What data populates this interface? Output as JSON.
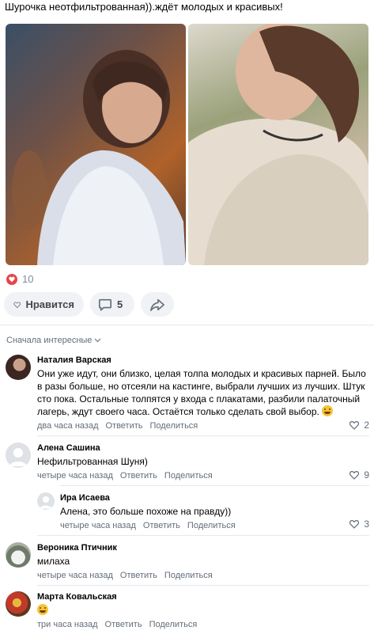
{
  "post": {
    "text": "Шурочка неотфильтрованная)).ждёт молодых и красивых!",
    "likes_count": "10"
  },
  "actions": {
    "like_label": "Нравится",
    "comments_count": "5"
  },
  "comments_header": {
    "sort_label": "Сначала интересные"
  },
  "comments": [
    {
      "author": "Наталия Варская",
      "text": "Они уже идут, они близко, целая толпа молодых и красивых парней. Было в разы больше, но отсеяли на кастинге, выбрали лучших из лучших. Штук сто пока. Остальные толпятся у входа с плакатами, разбили палаточный лагерь, ждут своего часа. Остаётся только сделать свой выбор.",
      "time": "два часа назад",
      "reply_label": "Ответить",
      "share_label": "Поделиться",
      "likes": "2"
    },
    {
      "author": "Алена Сашина",
      "text": "Нефильтрованная Шуня)",
      "time": "четыре часа назад",
      "reply_label": "Ответить",
      "share_label": "Поделиться",
      "likes": "9"
    },
    {
      "author": "Ира Исаева",
      "text": "Алена, это больше похоже на правду))",
      "time": "четыре часа назад",
      "reply_label": "Ответить",
      "share_label": "Поделиться",
      "likes": "3"
    },
    {
      "author": "Вероника Птичник",
      "text": "милаха",
      "time": "четыре часа назад",
      "reply_label": "Ответить",
      "share_label": "Поделиться"
    },
    {
      "author": "Марта Ковальская",
      "text": "",
      "time": "три часа назад",
      "reply_label": "Ответить",
      "share_label": "Поделиться"
    }
  ],
  "colors": {
    "accent": "#e64646",
    "secondary_text": "#818c99",
    "button_bg": "#f0f2f5"
  }
}
